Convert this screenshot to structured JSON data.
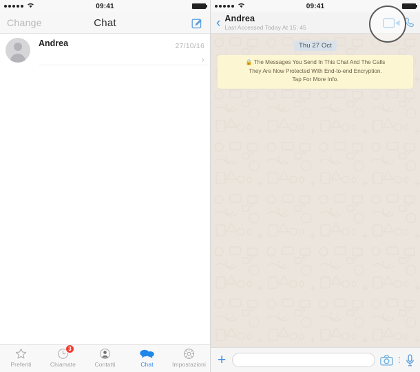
{
  "status_bar": {
    "signal_dots": 5,
    "wifi_icon": "wifi-icon",
    "time": "09:41",
    "battery_icon": "battery-full-icon"
  },
  "left_screen": {
    "nav": {
      "back_label": "Change",
      "title": "Chat",
      "compose_icon": "compose-icon"
    },
    "chat_list": [
      {
        "avatar_icon": "person-avatar-icon",
        "name": "Andrea",
        "date": "27/10/16",
        "chevron_icon": "chevron-right-icon"
      }
    ],
    "tabbar": [
      {
        "label": "Preferiti",
        "icon": "star-icon",
        "active": false,
        "badge": null
      },
      {
        "label": "Chiamate",
        "icon": "recent-calls-clock-icon",
        "active": false,
        "badge": "3"
      },
      {
        "label": "Contatti",
        "icon": "contacts-person-icon",
        "active": false,
        "badge": null
      },
      {
        "label": "Chat",
        "icon": "chat-bubbles-icon",
        "active": true,
        "badge": null
      },
      {
        "label": "Impostazioni",
        "icon": "settings-gear-icon",
        "active": false,
        "badge": null
      }
    ]
  },
  "right_screen": {
    "nav": {
      "back_icon": "back-chevron-icon",
      "peer_name": "Andrea",
      "peer_status": "Last Accessed Today At 15: 45",
      "video_call_icon": "video-call-icon",
      "voice_call_icon": "phone-call-icon",
      "highlight_ring": "highlight-circle"
    },
    "conversation": {
      "date_pill": "Thu 27 Oct",
      "encryption_notice": {
        "lock_icon": "lock-icon",
        "line1": "The Messages You Send In This Chat And The Calls",
        "line2": "They Are Now Protected With End-to-end Encryption.",
        "line3": "Tap For More Info."
      }
    },
    "inputbar": {
      "attach_label": "+",
      "input_value": "",
      "input_placeholder": "",
      "camera_icon": "camera-icon",
      "mic_icon": "microphone-icon"
    }
  },
  "colors": {
    "ios_blue": "#3b8fe0",
    "tab_active": "#2f8ef0",
    "badge_red": "#f5382c",
    "chat_bg": "#ece5dd",
    "encryption_bg": "#fdf6d3",
    "date_pill_bg": "#d9e2ea",
    "highlight_ring": "#5a5a5a"
  }
}
